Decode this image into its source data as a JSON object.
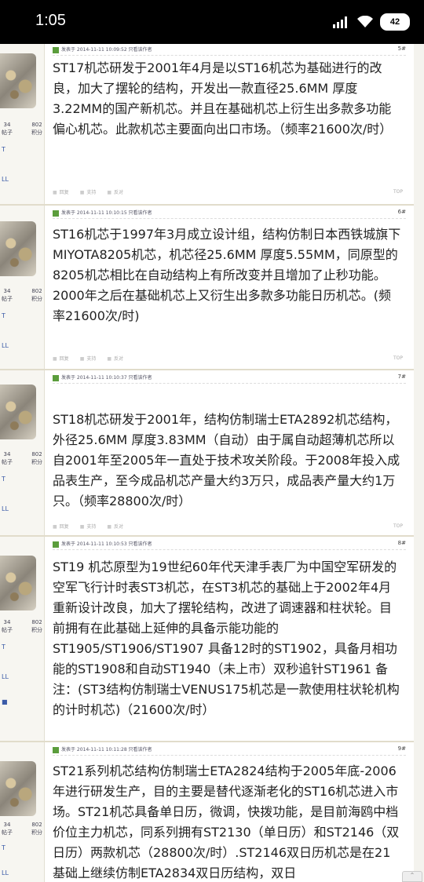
{
  "status_bar": {
    "time": "1:05",
    "battery": "42"
  },
  "posts": [
    {
      "floor": "5#",
      "meta": "发表于 2014-11-11 10:09:52  只看该作者",
      "stats": [
        "34",
        "802"
      ],
      "stats_labels": [
        "帖子",
        "积分"
      ],
      "body": "ST17机芯研发于2001年4月是以ST16机芯为基础进行的改良，加大了摆轮的结构，开发出一款直径25.6MM 厚度3.22MM的国产新机芯。并且在基础机芯上衍生出多款多功能偏心机芯。此款机芯主要面向出口市场。（频率21600次/时）",
      "actions": [
        "回复",
        "支持",
        "反对",
        "举报"
      ],
      "top": "TOP"
    },
    {
      "floor": "6#",
      "meta": "发表于 2014-11-11 10:10:15  只看该作者",
      "stats": [
        "34",
        "802"
      ],
      "stats_labels": [
        "帖子",
        "积分"
      ],
      "body": "ST16机芯于1997年3月成立设计组，结构仿制日本西铁城旗下MIYOTA8205机芯，机芯径25.6MM 厚度5.55MM，同原型的8205机芯相比在自动结构上有所改变并且增加了止秒功能。2000年之后在基础机芯上又衍生出多款多功能日历机芯。(频率21600次/时)",
      "actions": [
        "回复",
        "支持",
        "反对",
        "举报"
      ],
      "top": "TOP"
    },
    {
      "floor": "7#",
      "meta": "发表于 2014-11-11 10:10:37  只看该作者",
      "stats": [
        "34",
        "802"
      ],
      "stats_labels": [
        "帖子",
        "积分"
      ],
      "body": "ST18机芯研发于2001年，结构仿制瑞士ETA2892机芯结构，外径25.6MM 厚度3.83MM（自动）由于属自动超薄机芯所以自2001年至2005年一直处于技术攻关阶段。于2008年投入成品表生产，至今成品机芯产量大约3万只，成品表产量大约1万只。（频率28800次/时）",
      "actions": [
        "回复",
        "支持",
        "反对",
        "举报"
      ],
      "top": "TOP"
    },
    {
      "floor": "8#",
      "meta": "发表于 2014-11-11 10:10:53  只看该作者",
      "stats": [
        "34",
        "802"
      ],
      "stats_labels": [
        "帖子",
        "积分"
      ],
      "body": "ST19 机芯原型为19世纪60年代天津手表厂为中国空军研发的空军飞行计时表ST3机芯，在ST3机芯的基础上于2002年4月重新设计改良，加大了摆轮结构，改进了调速器和柱状轮。目前拥有在此基础上延伸的具备示能功能的ST1905/ST1906/ST1907 具备12时的ST1902，具备月相功能的ST1908和自动ST1940（未上市）双秒追针ST1961 备注：(ST3结构仿制瑞士VENUS175机芯是一款使用柱状轮机构的计时机芯)（21600次/时）",
      "actions": [
        "回复",
        "支持",
        "反对",
        "举报"
      ],
      "top": "TOP"
    },
    {
      "floor": "9#",
      "meta": "发表于 2014-11-11 10:11:28  只看该作者",
      "stats": [
        "34",
        "802"
      ],
      "stats_labels": [
        "帖子",
        "积分"
      ],
      "body": "ST21系列机芯结构仿制瑞士ETA2824结构于2005年底-2006年进行研发生产，目的主要是替代逐渐老化的ST16机芯进入市场。ST21机芯具备单日历，微调，快拨功能，是目前海鸥中档价位主力机芯，同系列拥有ST2130（单日历）和ST2146（双日历）两款机芯（28800次/时）.ST2146双日历机芯是在21基础上继续仿制ETA2834双日历结构，双日",
      "actions": [],
      "top": ""
    }
  ]
}
